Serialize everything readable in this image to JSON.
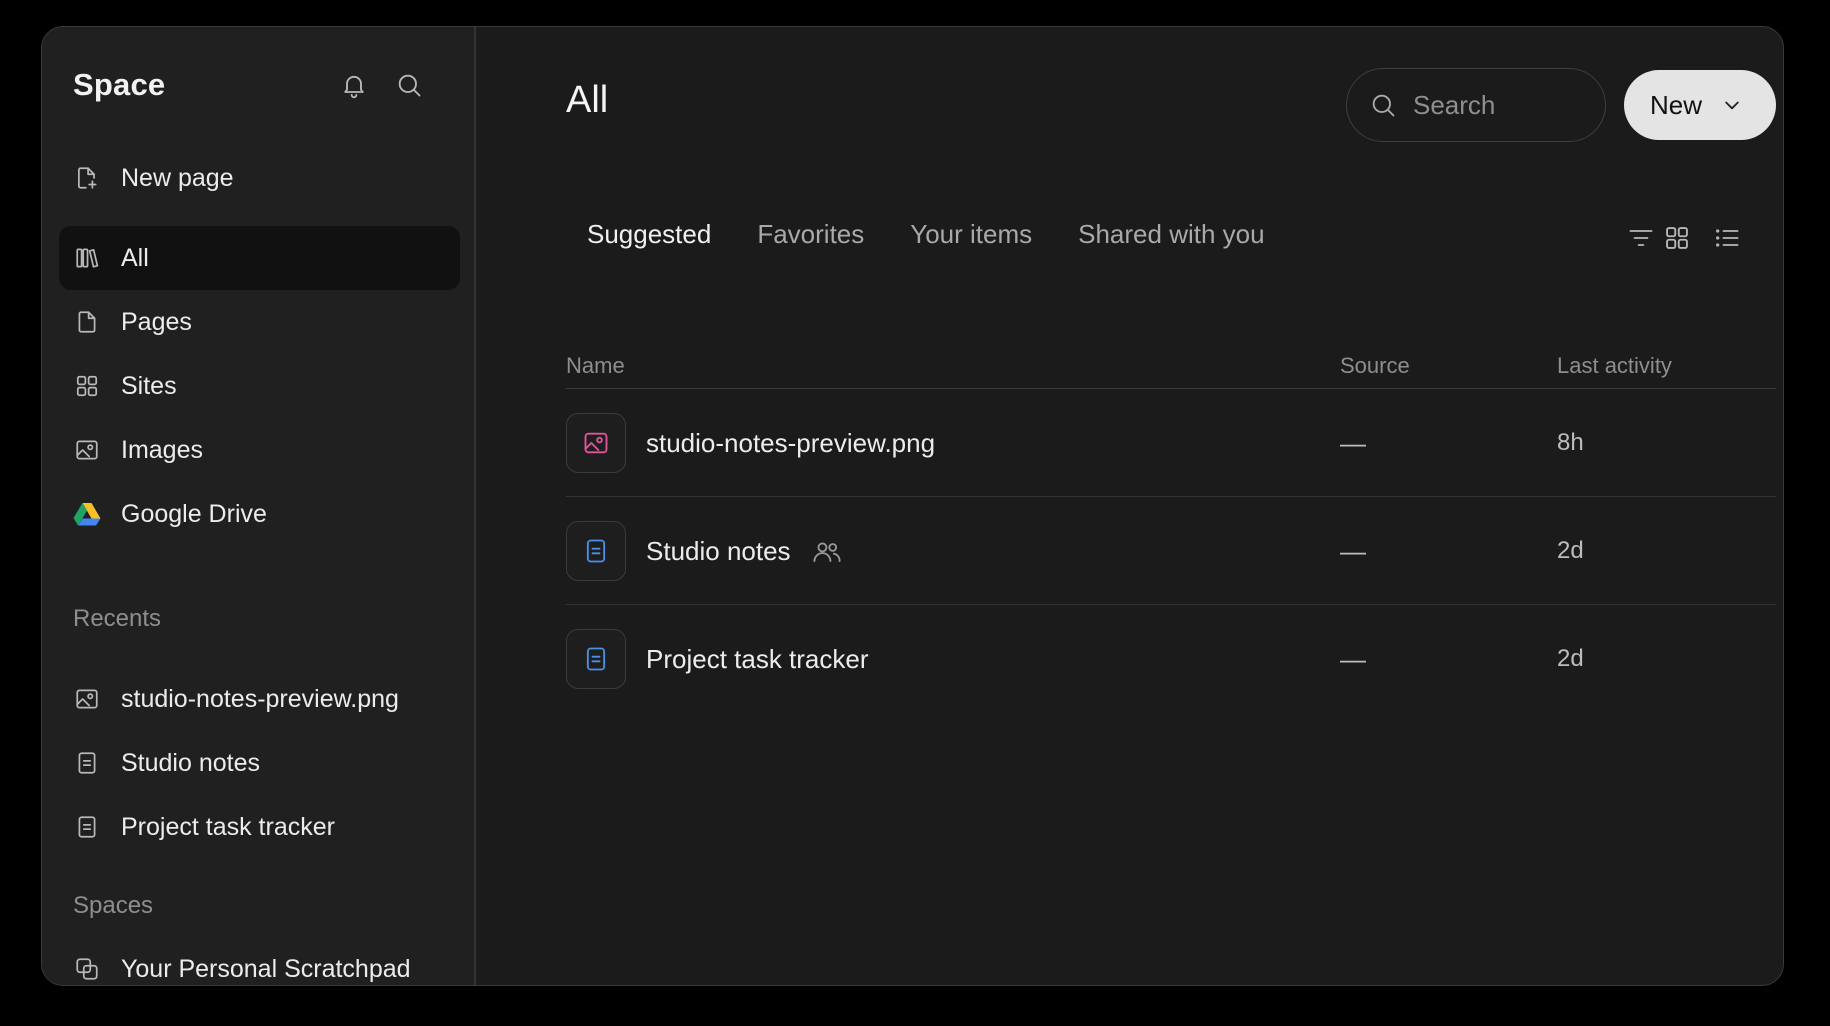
{
  "sidebar": {
    "brand": "Space",
    "nav": [
      {
        "label": "New page",
        "icon": "new-page-icon"
      },
      {
        "label": "All",
        "icon": "library-icon",
        "active": true
      },
      {
        "label": "Pages",
        "icon": "page-icon"
      },
      {
        "label": "Sites",
        "icon": "sites-icon"
      },
      {
        "label": "Images",
        "icon": "image-icon"
      },
      {
        "label": "Google Drive",
        "icon": "google-drive-icon"
      }
    ],
    "recents_label": "Recents",
    "recents": [
      {
        "label": "studio-notes-preview.png",
        "icon": "image-icon"
      },
      {
        "label": "Studio notes",
        "icon": "document-icon"
      },
      {
        "label": "Project task tracker",
        "icon": "document-icon"
      }
    ],
    "spaces_label": "Spaces",
    "spaces": [
      {
        "label": "Your Personal Scratchpad",
        "icon": "scratchpad-icon"
      }
    ]
  },
  "main": {
    "title": "All",
    "search_placeholder": "Search",
    "new_button": "New",
    "tabs": [
      {
        "label": "Suggested",
        "active": true
      },
      {
        "label": "Favorites"
      },
      {
        "label": "Your items"
      },
      {
        "label": "Shared with you"
      }
    ],
    "columns": {
      "name": "Name",
      "source": "Source",
      "last_activity": "Last activity"
    },
    "rows": [
      {
        "name": "studio-notes-preview.png",
        "icon": "image-file-icon",
        "shared": false,
        "source": "—",
        "last_activity": "8h"
      },
      {
        "name": "Studio notes",
        "icon": "document-file-icon",
        "shared": true,
        "source": "—",
        "last_activity": "2d"
      },
      {
        "name": "Project task tracker",
        "icon": "document-file-icon",
        "shared": false,
        "source": "—",
        "last_activity": "2d"
      }
    ]
  },
  "colors": {
    "background": "#1b1b1b",
    "sidebar": "#202020",
    "active_item": "#111111",
    "image_icon_accent": "#e0559a",
    "document_icon_accent": "#4c8fe8",
    "new_button": "#e4e4e4"
  }
}
